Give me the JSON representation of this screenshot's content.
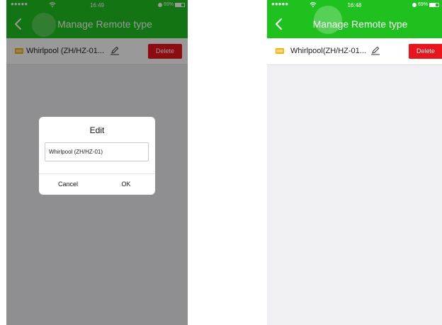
{
  "colors": {
    "brand_green": "#1ec11e",
    "delete_red": "#e9141c",
    "background": "#efeff4"
  },
  "left": {
    "status": {
      "signal": "●●●●●",
      "time": "16:49",
      "battery": "69%",
      "battery_level": 0.69
    },
    "nav": {
      "title": "Manage Remote type",
      "back_icon": "chevron-left-icon"
    },
    "row": {
      "name": "Whirlpool (ZH/HZ-01...",
      "edit_icon": "pencil-icon",
      "delete_label": "Delete",
      "device_icon": "remote-icon"
    },
    "dialog": {
      "title": "Edit",
      "input_value": "Whirlpool (ZH/HZ-01)",
      "cancel_label": "Cancel",
      "ok_label": "OK"
    }
  },
  "right": {
    "status": {
      "signal": "●●●●●",
      "time": "16:48",
      "battery": "69%",
      "battery_level": 0.69
    },
    "nav": {
      "title": "Manage Remote type",
      "back_icon": "chevron-left-icon"
    },
    "row": {
      "name": "Whirlpool(ZH/HZ-01...",
      "edit_icon": "pencil-icon",
      "delete_label": "Delete",
      "device_icon": "remote-icon"
    }
  }
}
